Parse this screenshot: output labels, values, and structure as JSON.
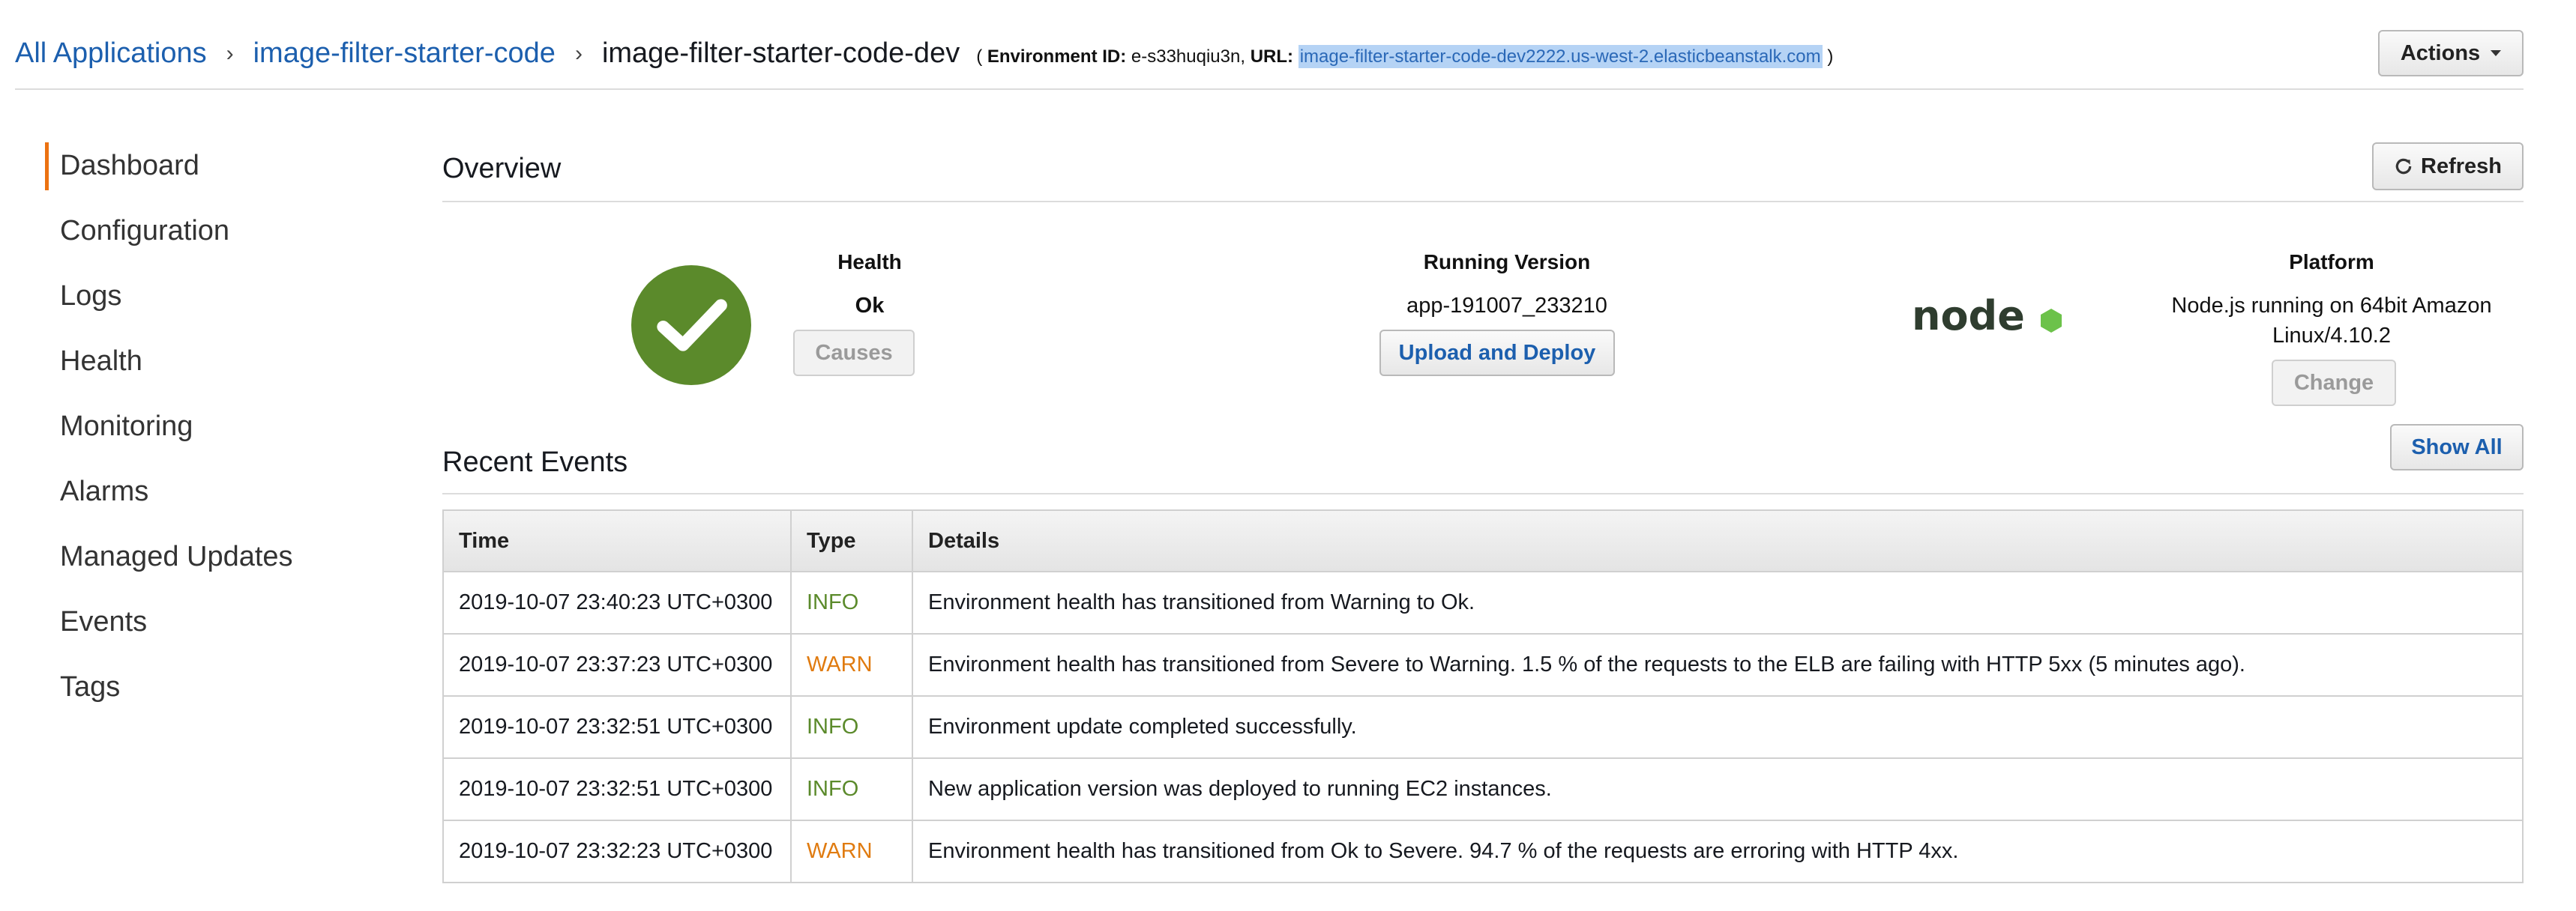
{
  "breadcrumb": {
    "all_apps": "All Applications",
    "app": "image-filter-starter-code",
    "env": "image-filter-starter-code-dev",
    "meta_open": "( ",
    "env_id_label": "Environment ID:",
    "env_id": "e-s33huqiu3n,",
    "url_label": "URL:",
    "url": "image-filter-starter-code-dev2222.us-west-2.elasticbeanstalk.com",
    "meta_close": " )"
  },
  "actions_label": "Actions",
  "sidebar": {
    "items": [
      {
        "label": "Dashboard",
        "active": true
      },
      {
        "label": "Configuration"
      },
      {
        "label": "Logs"
      },
      {
        "label": "Health"
      },
      {
        "label": "Monitoring"
      },
      {
        "label": "Alarms"
      },
      {
        "label": "Managed Updates"
      },
      {
        "label": "Events"
      },
      {
        "label": "Tags"
      }
    ]
  },
  "overview": {
    "title": "Overview",
    "refresh_label": "Refresh",
    "health": {
      "label": "Health",
      "status": "Ok",
      "button": "Causes"
    },
    "version": {
      "label": "Running Version",
      "value": "app-191007_233210",
      "button": "Upload and Deploy"
    },
    "platform": {
      "label": "Platform",
      "logo_text": "node",
      "line1": "Node.js running on 64bit Amazon",
      "line2": "Linux/4.10.2",
      "button": "Change"
    }
  },
  "events": {
    "title": "Recent Events",
    "show_all": "Show All",
    "columns": [
      "Time",
      "Type",
      "Details"
    ],
    "rows": [
      {
        "time": "2019-10-07 23:40:23 UTC+0300",
        "type": "INFO",
        "details": "Environment health has transitioned from Warning to Ok."
      },
      {
        "time": "2019-10-07 23:37:23 UTC+0300",
        "type": "WARN",
        "details": "Environment health has transitioned from Severe to Warning. 1.5 % of the requests to the ELB are failing with HTTP 5xx (5 minutes ago)."
      },
      {
        "time": "2019-10-07 23:32:51 UTC+0300",
        "type": "INFO",
        "details": "Environment update completed successfully."
      },
      {
        "time": "2019-10-07 23:32:51 UTC+0300",
        "type": "INFO",
        "details": "New application version was deployed to running EC2 instances."
      },
      {
        "time": "2019-10-07 23:32:23 UTC+0300",
        "type": "WARN",
        "details": "Environment health has transitioned from Ok to Severe. 94.7 % of the requests are erroring with HTTP 4xx."
      }
    ]
  },
  "colors": {
    "link": "#1c5fae",
    "active_accent": "#ec7211",
    "health_ok": "#5b8a2b",
    "warn": "#e07b10",
    "url_highlight": "#b5d3f5"
  },
  "icons": {
    "health": "checkmark-circle-icon",
    "refresh": "refresh-icon",
    "actions": "caret-down-icon",
    "platform": "nodejs-logo"
  }
}
